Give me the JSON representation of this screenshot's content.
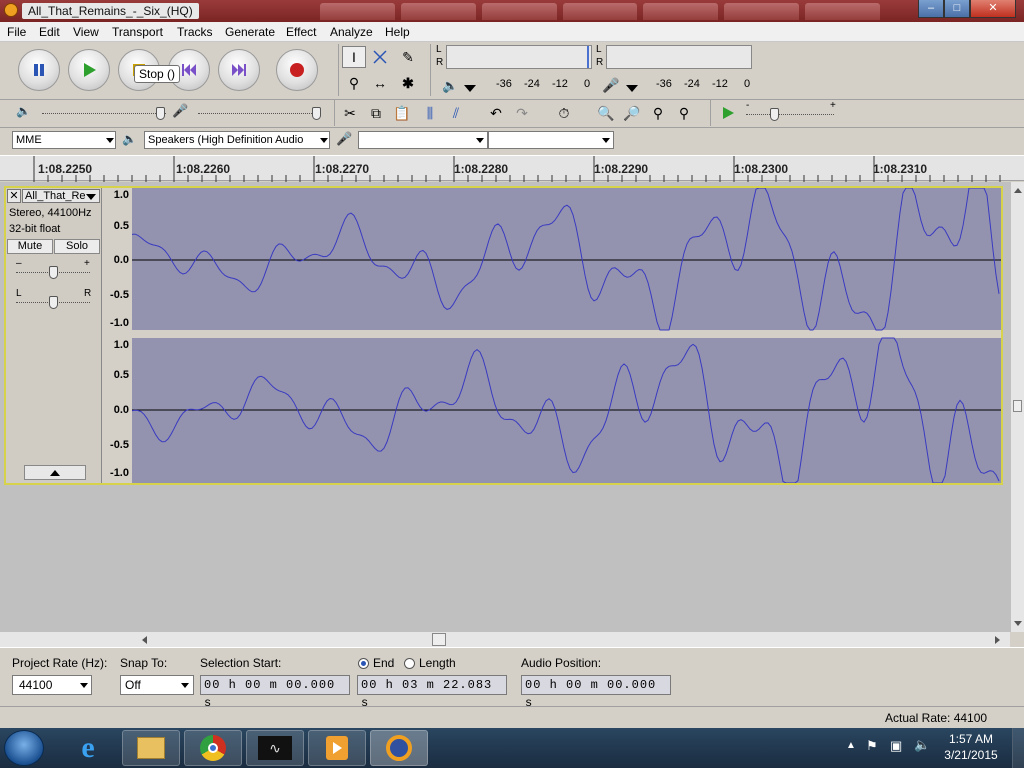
{
  "window": {
    "title": "All_That_Remains_-_Six_(HQ)",
    "controls": [
      "–",
      "□",
      "✕"
    ]
  },
  "menu": [
    "File",
    "Edit",
    "View",
    "Transport",
    "Tracks",
    "Generate",
    "Effect",
    "Analyze",
    "Help"
  ],
  "transport": {
    "tooltip": "Stop ()"
  },
  "meters": {
    "play_L": "L",
    "play_R": "R",
    "rec_L": "L",
    "rec_R": "R",
    "scale": [
      "-36",
      "-24",
      "-12",
      "0"
    ]
  },
  "devices": {
    "host": "MME",
    "output": "Speakers (High Definition Audio",
    "input": "",
    "channels": ""
  },
  "ruler": [
    "1:08.2250",
    "1:08.2260",
    "1:08.2270",
    "1:08.2280",
    "1:08.2290",
    "1:08.2300",
    "1:08.2310"
  ],
  "track": {
    "name": "All_That_Re",
    "info1": "Stereo, 44100Hz",
    "info2": "32-bit float",
    "mute": "Mute",
    "solo": "Solo",
    "gain_minus": "–",
    "gain_plus": "+",
    "pan_L": "L",
    "pan_R": "R",
    "scale": [
      "1.0",
      "0.5",
      "0.0",
      "-0.5",
      "-1.0"
    ],
    "wave_color": "#3a3ac0"
  },
  "selection": {
    "project_rate_label": "Project Rate (Hz):",
    "project_rate": "44100",
    "snap_label": "Snap To:",
    "snap": "Off",
    "start_label": "Selection Start:",
    "end_label": "End",
    "length_label": "Length",
    "position_label": "Audio Position:",
    "start": "00 h 00 m 00.000 s",
    "end": "00 h 03 m 22.083 s",
    "position": "00 h 00 m 00.000 s"
  },
  "status": {
    "actual_rate": "Actual Rate: 44100"
  },
  "taskbar": {
    "time": "1:57 AM",
    "date": "3/21/2015"
  }
}
